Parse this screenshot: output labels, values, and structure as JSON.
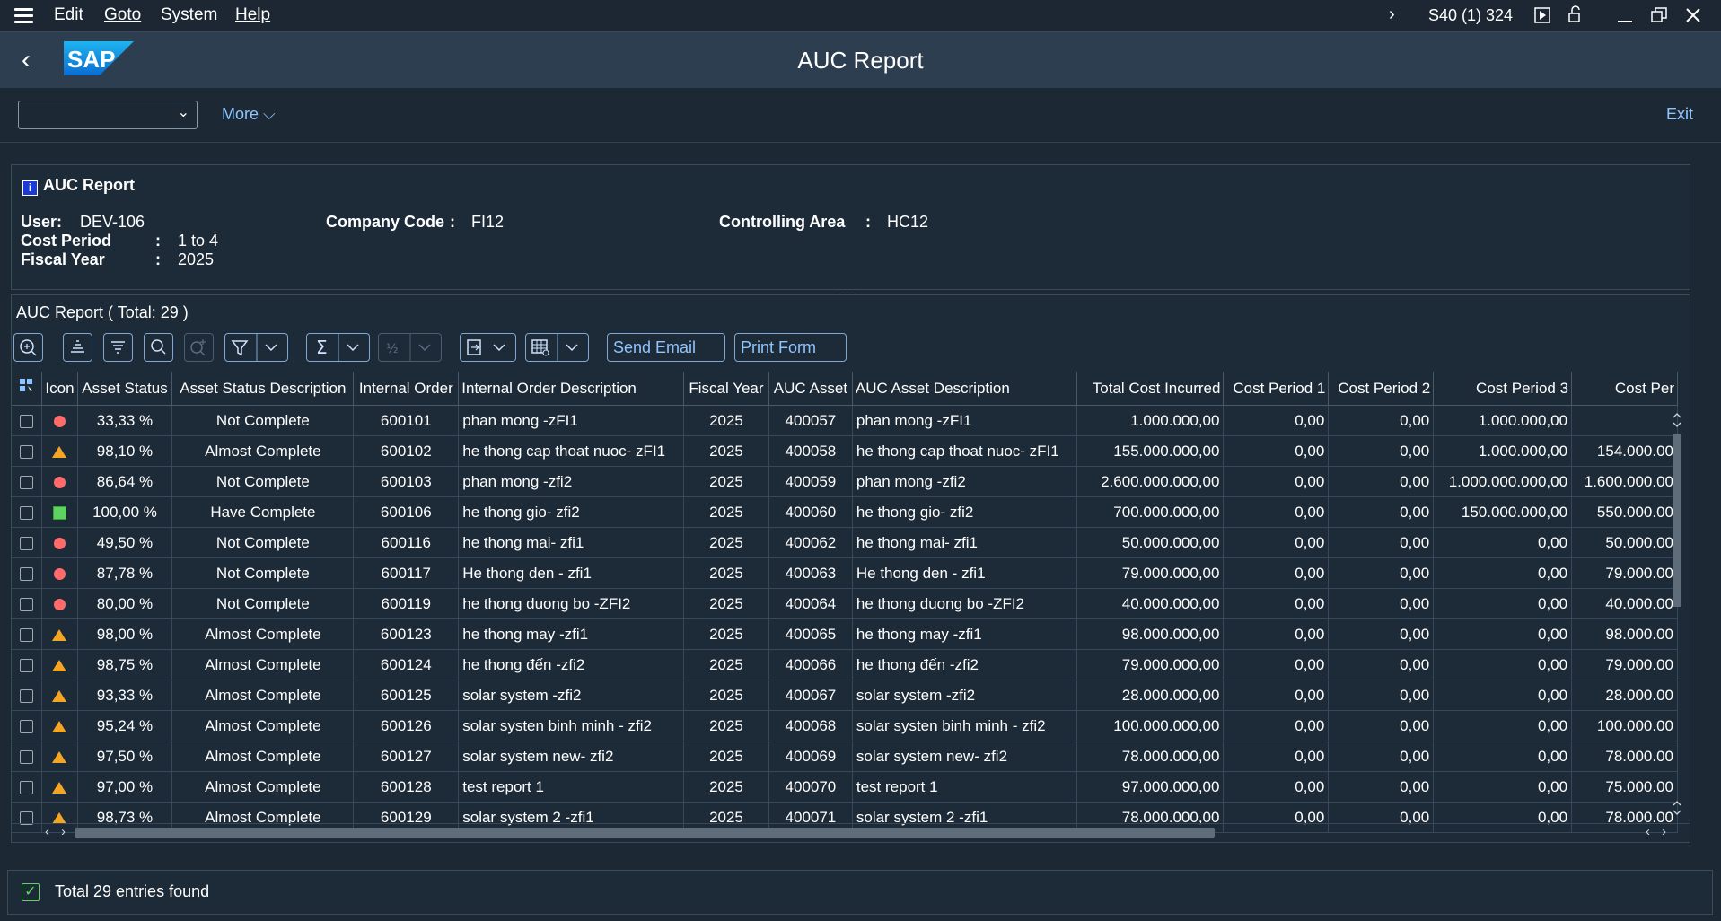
{
  "menubar": {
    "items": [
      "Edit",
      "Goto",
      "System",
      "Help"
    ],
    "system_info": "S40 (1) 324"
  },
  "shell": {
    "title": "AUC Report"
  },
  "toolbar": {
    "more_label": "More",
    "exit_label": "Exit"
  },
  "header": {
    "title": "AUC Report",
    "user_label": "User:",
    "user_value": "DEV-106",
    "company_label": "Company Code",
    "company_sep": ":",
    "company_value": "FI12",
    "ctrl_label": "Controlling Area",
    "ctrl_sep": ":",
    "ctrl_value": "HC12",
    "period_label": "Cost Period",
    "period_sep": ":",
    "period_value": "1 to 4",
    "fy_label": "Fiscal Year",
    "fy_sep": ":",
    "fy_value": "2025"
  },
  "grid": {
    "title": "AUC Report ( Total:  29 )",
    "send_email_label": "Send Email",
    "print_form_label": "Print Form",
    "columns": [
      "Icon",
      "Asset Status",
      "Asset Status Description",
      "Internal Order",
      "Internal Order Description",
      "Fiscal Year",
      "AUC Asset",
      "AUC Asset Description",
      "Total Cost Incurred",
      "Cost Period 1",
      "Cost Period 2",
      "Cost Period 3",
      "Cost Per"
    ],
    "rows": [
      {
        "icon": "red-circle",
        "status": "33,33 %",
        "desc": "Not Complete",
        "order": "600101",
        "order_desc": "phan mong -zFI1",
        "fy": "2025",
        "asset": "400057",
        "asset_desc": "phan mong -zFI1",
        "total": "1.000.000,00",
        "p1": "0,00",
        "p2": "0,00",
        "p3": "1.000.000,00",
        "p4": ""
      },
      {
        "icon": "yellow-triangle",
        "status": "98,10 %",
        "desc": "Almost Complete",
        "order": "600102",
        "order_desc": "he thong cap thoat nuoc- zFI1",
        "fy": "2025",
        "asset": "400058",
        "asset_desc": "he thong cap thoat nuoc- zFI1",
        "total": "155.000.000,00",
        "p1": "0,00",
        "p2": "0,00",
        "p3": "1.000.000,00",
        "p4": "154.000.00"
      },
      {
        "icon": "red-circle",
        "status": "86,64 %",
        "desc": "Not Complete",
        "order": "600103",
        "order_desc": "phan mong -zfi2",
        "fy": "2025",
        "asset": "400059",
        "asset_desc": "phan mong -zfi2",
        "total": "2.600.000.000,00",
        "p1": "0,00",
        "p2": "0,00",
        "p3": "1.000.000.000,00",
        "p4": "1.600.000.00"
      },
      {
        "icon": "green-square",
        "status": "100,00 %",
        "desc": "Have Complete",
        "order": "600106",
        "order_desc": "he thong gio- zfi2",
        "fy": "2025",
        "asset": "400060",
        "asset_desc": "he thong gio- zfi2",
        "total": "700.000.000,00",
        "p1": "0,00",
        "p2": "0,00",
        "p3": "150.000.000,00",
        "p4": "550.000.00"
      },
      {
        "icon": "red-circle",
        "status": "49,50 %",
        "desc": "Not Complete",
        "order": "600116",
        "order_desc": "he thong mai- zfi1",
        "fy": "2025",
        "asset": "400062",
        "asset_desc": "he thong mai- zfi1",
        "total": "50.000.000,00",
        "p1": "0,00",
        "p2": "0,00",
        "p3": "0,00",
        "p4": "50.000.00"
      },
      {
        "icon": "red-circle",
        "status": "87,78 %",
        "desc": "Not Complete",
        "order": "600117",
        "order_desc": "He thong den - zfi1",
        "fy": "2025",
        "asset": "400063",
        "asset_desc": "He thong den - zfi1",
        "total": "79.000.000,00",
        "p1": "0,00",
        "p2": "0,00",
        "p3": "0,00",
        "p4": "79.000.00"
      },
      {
        "icon": "red-circle",
        "status": "80,00 %",
        "desc": "Not Complete",
        "order": "600119",
        "order_desc": "he thong duong bo -ZFI2",
        "fy": "2025",
        "asset": "400064",
        "asset_desc": "he thong duong bo -ZFI2",
        "total": "40.000.000,00",
        "p1": "0,00",
        "p2": "0,00",
        "p3": "0,00",
        "p4": "40.000.00"
      },
      {
        "icon": "yellow-triangle",
        "status": "98,00 %",
        "desc": "Almost Complete",
        "order": "600123",
        "order_desc": "he thong may -zfi1",
        "fy": "2025",
        "asset": "400065",
        "asset_desc": "he thong may -zfi1",
        "total": "98.000.000,00",
        "p1": "0,00",
        "p2": "0,00",
        "p3": "0,00",
        "p4": "98.000.00"
      },
      {
        "icon": "yellow-triangle",
        "status": "98,75 %",
        "desc": "Almost Complete",
        "order": "600124",
        "order_desc": "he thong đến -zfi2",
        "fy": "2025",
        "asset": "400066",
        "asset_desc": "he thong đến -zfi2",
        "total": "79.000.000,00",
        "p1": "0,00",
        "p2": "0,00",
        "p3": "0,00",
        "p4": "79.000.00"
      },
      {
        "icon": "yellow-triangle",
        "status": "93,33 %",
        "desc": "Almost Complete",
        "order": "600125",
        "order_desc": "solar system -zfi2",
        "fy": "2025",
        "asset": "400067",
        "asset_desc": "solar system -zfi2",
        "total": "28.000.000,00",
        "p1": "0,00",
        "p2": "0,00",
        "p3": "0,00",
        "p4": "28.000.00"
      },
      {
        "icon": "yellow-triangle",
        "status": "95,24 %",
        "desc": "Almost Complete",
        "order": "600126",
        "order_desc": "solar systen binh minh - zfi2",
        "fy": "2025",
        "asset": "400068",
        "asset_desc": "solar systen binh minh - zfi2",
        "total": "100.000.000,00",
        "p1": "0,00",
        "p2": "0,00",
        "p3": "0,00",
        "p4": "100.000.00"
      },
      {
        "icon": "yellow-triangle",
        "status": "97,50 %",
        "desc": "Almost Complete",
        "order": "600127",
        "order_desc": "solar system new- zfi2",
        "fy": "2025",
        "asset": "400069",
        "asset_desc": "solar system new- zfi2",
        "total": "78.000.000,00",
        "p1": "0,00",
        "p2": "0,00",
        "p3": "0,00",
        "p4": "78.000.00"
      },
      {
        "icon": "yellow-triangle",
        "status": "97,00 %",
        "desc": "Almost Complete",
        "order": "600128",
        "order_desc": "test report 1",
        "fy": "2025",
        "asset": "400070",
        "asset_desc": "test report 1",
        "total": "97.000.000,00",
        "p1": "0,00",
        "p2": "0,00",
        "p3": "0,00",
        "p4": "75.000.00"
      },
      {
        "icon": "yellow-triangle",
        "status": "98,73 %",
        "desc": "Almost Complete",
        "order": "600129",
        "order_desc": "solar system 2 -zfi1",
        "fy": "2025",
        "asset": "400071",
        "asset_desc": "solar system 2 -zfi1",
        "total": "78.000.000,00",
        "p1": "0,00",
        "p2": "0,00",
        "p3": "0,00",
        "p4": "78.000.00"
      }
    ]
  },
  "status": {
    "message": "Total 29 entries found"
  },
  "colors": {
    "bg": "#1c2834",
    "shell": "#2c3e50",
    "accent": "#8fc5ff",
    "red": "#ff6b6b",
    "amber": "#f5a524",
    "green": "#5fd35f"
  }
}
